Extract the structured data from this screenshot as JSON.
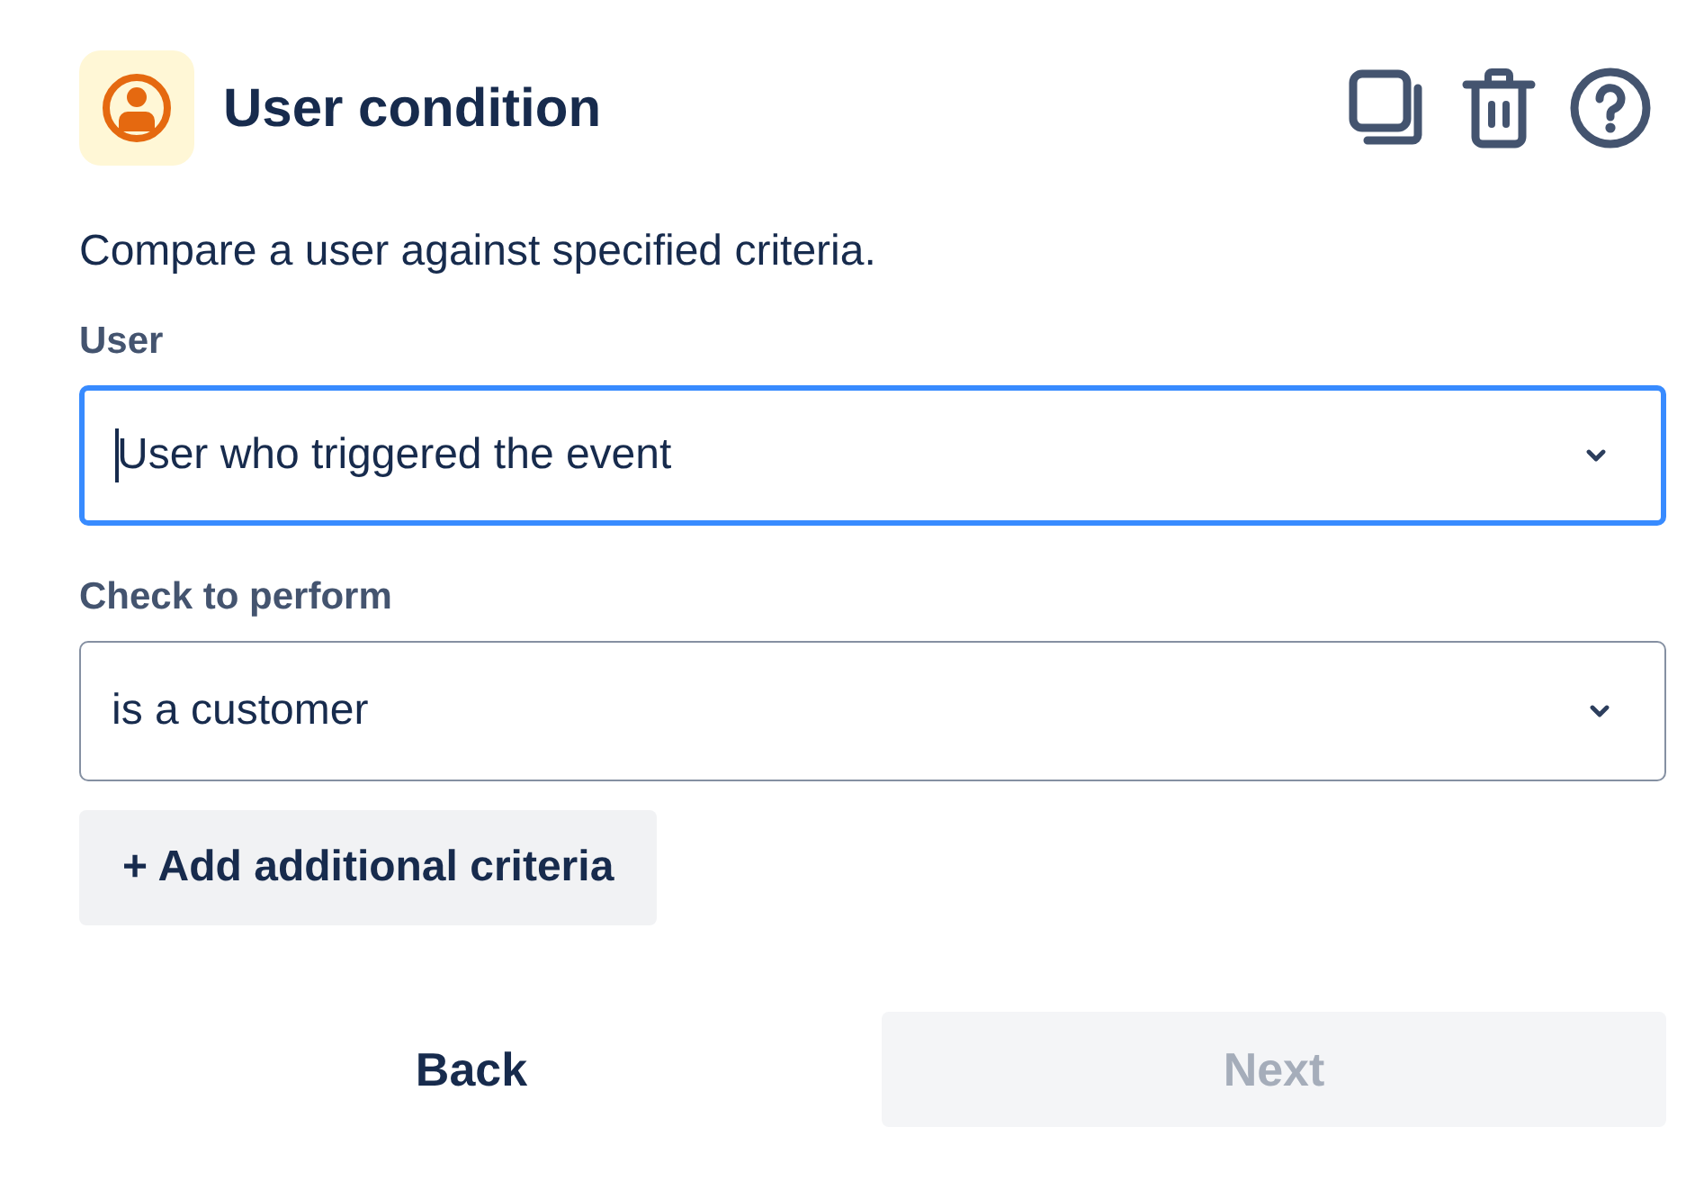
{
  "header": {
    "title": "User condition"
  },
  "description": "Compare a user against specified criteria.",
  "fields": [
    {
      "label": "User",
      "value": "User who triggered the event",
      "focused": true
    },
    {
      "label": "Check to perform",
      "value": "is a customer",
      "focused": false
    }
  ],
  "add_button": "+ Add additional criteria",
  "buttons": [
    {
      "label": "Back",
      "disabled": false
    },
    {
      "label": "Next",
      "disabled": true
    }
  ]
}
